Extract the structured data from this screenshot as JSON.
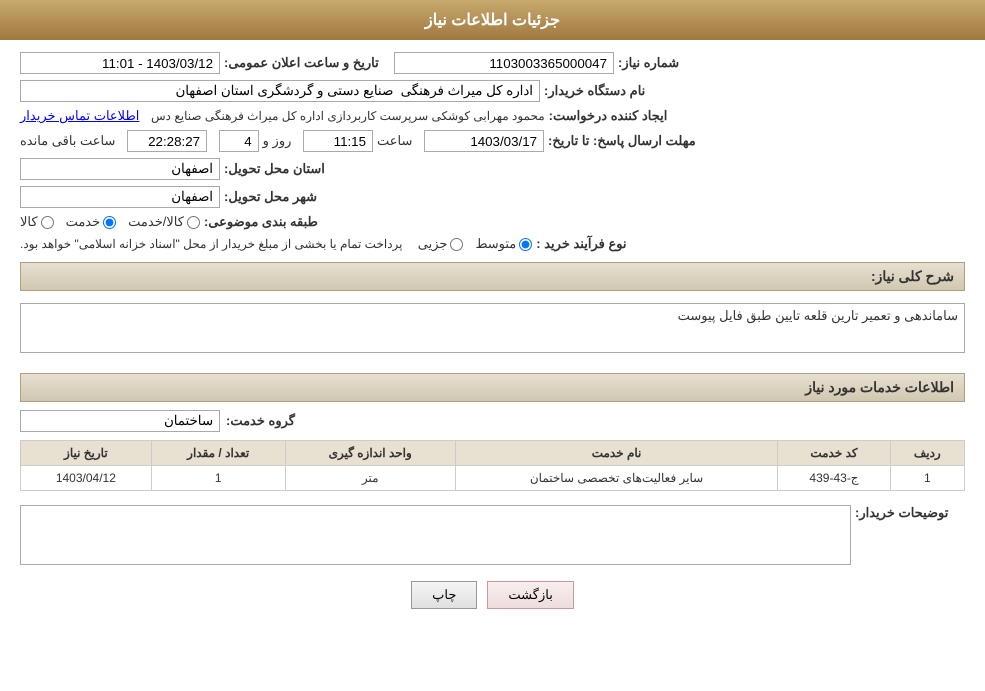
{
  "header": {
    "title": "جزئیات اطلاعات نیاز"
  },
  "fields": {
    "shomara_niaz_label": "شماره نیاز:",
    "shomara_niaz_value": "1103003365000047",
    "name_dastgah_label": "نام دستگاه خریدار:",
    "name_dastgah_value": "اداره کل میراث فرهنگی  صنایع دستی و گردشگری استان اصفهان",
    "ijad_label": "ایجاد کننده درخواست:",
    "ijad_value": "محمود مهرابی کوشکی سرپرست کاربردازی اداره کل میراث فرهنگی  صنایع دس",
    "ijad_link": "اطلاعات تماس خریدار",
    "mohlat_label": "مهلت ارسال پاسخ: تا تاریخ:",
    "date_value": "1403/03/17",
    "saat_label": "ساعت",
    "saat_value": "11:15",
    "rooz_label": "روز و",
    "rooz_value": "4",
    "baqi_label": "ساعت باقی مانده",
    "baqi_value": "22:28:27",
    "tarikh_label": "تاریخ و ساعت اعلان عمومی:",
    "tarikh_value": "1403/03/12 - 11:01",
    "ostan_label": "استان محل تحویل:",
    "ostan_value": "اصفهان",
    "shahr_label": "شهر محل تحویل:",
    "shahr_value": "اصفهان",
    "tabaqe_label": "طبقه بندی موضوعی:",
    "tabaqe_options": [
      "کالا",
      "خدمت",
      "کالا/خدمت"
    ],
    "tabaqe_selected": "خدمت",
    "nooe_farayand_label": "نوع فرآیند خرید :",
    "nooe_options": [
      "جزیی",
      "متوسط"
    ],
    "nooe_selected": "متوسط",
    "nooe_desc": "پرداخت تمام یا بخشی از مبلغ خریدار از محل \"اسناد خزانه اسلامی\" خواهد بود.",
    "sharh_niaz_label": "شرح کلی نیاز:",
    "sharh_niaz_value": "ساماندهی و تعمیر تارین قلعه تایین طبق فایل پیوست",
    "khadamat_label": "اطلاعات خدمات مورد نیاز",
    "gorooh_label": "گروه خدمت:",
    "gorooh_value": "ساختمان",
    "table": {
      "headers": [
        "ردیف",
        "کد خدمت",
        "نام خدمت",
        "واحد اندازه گیری",
        "تعداد / مقدار",
        "تاریخ نیاز"
      ],
      "rows": [
        {
          "radif": "1",
          "kod": "ج-43-439",
          "name": "سایر فعالیت‌های تخصصی ساختمان",
          "vahed": "متر",
          "tedad": "1",
          "tarikh": "1403/04/12"
        }
      ]
    },
    "tawsif_label": "توضیحات خریدار:",
    "tawsif_value": "",
    "btn_bazgasht": "بازگشت",
    "btn_chap": "چاپ"
  }
}
